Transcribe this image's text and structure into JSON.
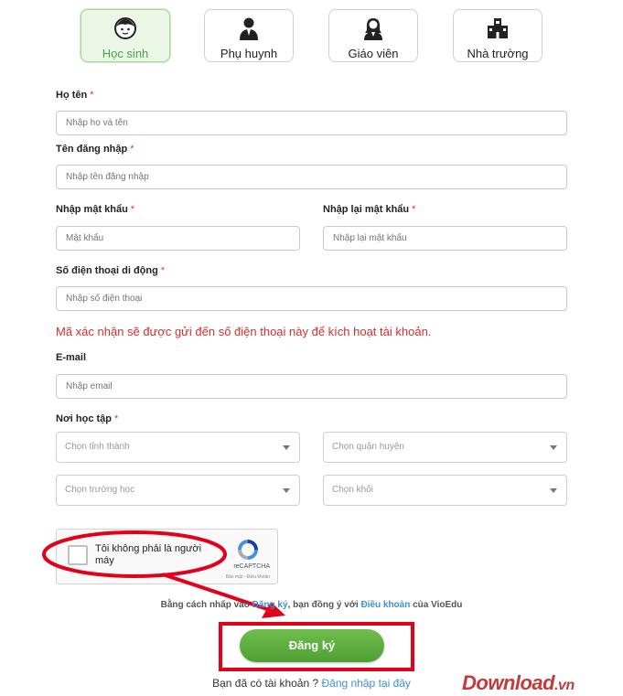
{
  "roles": [
    {
      "label": "Học sinh",
      "icon": "student-icon",
      "active": true
    },
    {
      "label": "Phụ huynh",
      "icon": "parent-icon",
      "active": false
    },
    {
      "label": "Giáo viên",
      "icon": "teacher-icon",
      "active": false
    },
    {
      "label": "Nhà trường",
      "icon": "school-icon",
      "active": false
    }
  ],
  "form": {
    "fullname": {
      "label": "Họ tên",
      "required": "*",
      "placeholder": "Nhập họ và tên"
    },
    "username": {
      "label": "Tên đăng nhập",
      "required": "*",
      "placeholder": "Nhập tên đăng nhập"
    },
    "password": {
      "label": "Nhập mật khẩu",
      "required": "*",
      "placeholder": "Mật khẩu"
    },
    "password_confirm": {
      "label": "Nhập lại mật khẩu",
      "required": "*",
      "placeholder": "Nhập lại mật khẩu"
    },
    "phone": {
      "label": "Số điện thoại di động",
      "required": "*",
      "placeholder": "Nhập số điện thoại"
    },
    "phone_note": "Mã xác nhận sẽ được gửi đến số điện thoại này để kích hoạt tài khoản.",
    "email": {
      "label": "E-mail",
      "placeholder": "Nhập email"
    },
    "school_place": {
      "label": "Nơi học tập",
      "required": "*"
    },
    "selects": {
      "province": "Chọn tỉnh thành",
      "district": "Chọn quận huyện",
      "school": "Chọn trường học",
      "grade": "Chọn khối"
    }
  },
  "captcha": {
    "text": "Tôi không phải là người máy",
    "brand": "reCAPTCHA",
    "links": "Bảo mật - Điều khoản"
  },
  "terms": {
    "prefix": "Bằng cách nhấp vào",
    "register_link": "Đăng ký",
    "middle": ", bạn đồng ý với",
    "terms_link": "Điều khoản",
    "suffix": "của VioEdu"
  },
  "submit_label": "Đăng ký",
  "login": {
    "prefix": "Bạn đã có tài khoản ?",
    "link": "Đăng nhập tại đây"
  },
  "watermark": {
    "main": "Download",
    "suffix": ".vn"
  },
  "colors": {
    "accent_green": "#5aad3d",
    "required_red": "#e53935",
    "link_blue": "#3f8fd2",
    "highlight_red": "#e3001b"
  }
}
